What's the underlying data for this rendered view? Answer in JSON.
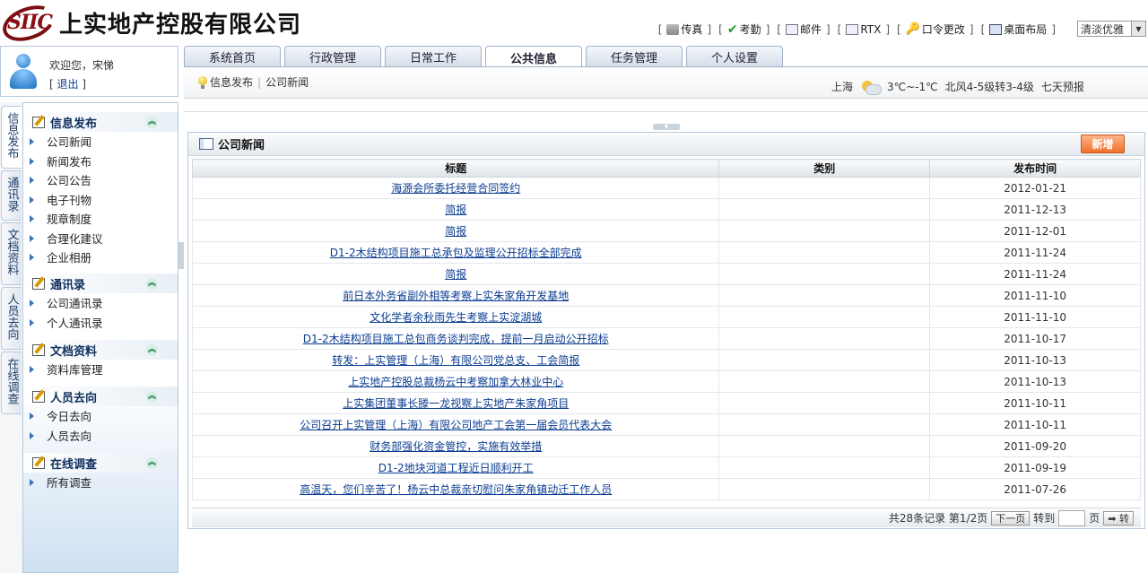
{
  "header": {
    "logo_letters": "SIIC",
    "company_name": "上实地产控股有限公司",
    "links": [
      {
        "label": "传真",
        "icon": "fax-icon"
      },
      {
        "label": "考勤",
        "icon": "check-icon"
      },
      {
        "label": "邮件",
        "icon": "mail-icon"
      },
      {
        "label": "RTX",
        "icon": "rtx-icon"
      },
      {
        "label": "口令更改",
        "icon": "key-icon"
      },
      {
        "label": "桌面布局",
        "icon": "desktop-icon"
      }
    ],
    "bracket_open": "[",
    "bracket_close": "]",
    "skin_select_value": "清淡优雅"
  },
  "user": {
    "welcome": "欢迎您，宋悌",
    "logout": "退出"
  },
  "tabs": [
    {
      "label": "系统首页"
    },
    {
      "label": "行政管理"
    },
    {
      "label": "日常工作"
    },
    {
      "label": "公共信息"
    },
    {
      "label": "任务管理"
    },
    {
      "label": "个人设置"
    }
  ],
  "breadcrumb": [
    "信息发布",
    "公司新闻"
  ],
  "weather": {
    "city": "上海",
    "temp": "3℃~-1℃",
    "wind": "北风4-5级转3-4级",
    "forecast_link": "七天预报"
  },
  "vtabs": [
    {
      "label": "信息发布"
    },
    {
      "label": "通讯录"
    },
    {
      "label": "文档资料"
    },
    {
      "label": "人员去向"
    },
    {
      "label": "在线调查"
    }
  ],
  "nav_groups": [
    {
      "title": "信息发布",
      "items": [
        "公司新闻",
        "新闻发布",
        "公司公告",
        "电子刊物",
        "规章制度",
        "合理化建议",
        "企业相册"
      ]
    },
    {
      "title": "通讯录",
      "items": [
        "公司通讯录",
        "个人通讯录"
      ]
    },
    {
      "title": "文档资料",
      "items": [
        "资料库管理"
      ]
    },
    {
      "title": "人员去向",
      "items": [
        "今日去向",
        "人员去向"
      ]
    },
    {
      "title": "在线调查",
      "items": [
        "所有调查"
      ]
    }
  ],
  "panel": {
    "title": "公司新闻",
    "new_button": "新增",
    "columns": [
      "标题",
      "类别",
      "发布时间"
    ],
    "rows": [
      {
        "title": "海源会所委托经营合同签约",
        "category": "",
        "date": "2012-01-21"
      },
      {
        "title": "简报",
        "category": "",
        "date": "2011-12-13"
      },
      {
        "title": "简报",
        "category": "",
        "date": "2011-12-01"
      },
      {
        "title": "D1-2木结构项目施工总承包及监理公开招标全部完成",
        "category": "",
        "date": "2011-11-24"
      },
      {
        "title": "简报",
        "category": "",
        "date": "2011-11-24"
      },
      {
        "title": "前日本外务省副外相等考察上实朱家角开发基地",
        "category": "",
        "date": "2011-11-10"
      },
      {
        "title": "文化学者余秋雨先生考察上实淀湖城",
        "category": "",
        "date": "2011-11-10"
      },
      {
        "title": "D1-2木结构项目施工总包商务谈判完成，提前一月启动公开招标",
        "category": "",
        "date": "2011-10-17"
      },
      {
        "title": "转发：上实管理（上海）有限公司党总支、工会简报",
        "category": "",
        "date": "2011-10-13"
      },
      {
        "title": "上实地产控股总裁杨云中考察加拿大林业中心",
        "category": "",
        "date": "2011-10-13"
      },
      {
        "title": "上实集团董事长滕一龙视察上实地产朱家角项目",
        "category": "",
        "date": "2011-10-11"
      },
      {
        "title": "公司召开上实管理（上海）有限公司地产工会第一届会员代表大会",
        "category": "",
        "date": "2011-10-11"
      },
      {
        "title": "财务部强化资金管控，实施有效举措",
        "category": "",
        "date": "2011-09-20"
      },
      {
        "title": "D1-2地块河道工程近日顺利开工",
        "category": "",
        "date": "2011-09-19"
      },
      {
        "title": "高温天，您们辛苦了！杨云中总裁亲切慰问朱家角镇动迁工作人员",
        "category": "",
        "date": "2011-07-26"
      }
    ],
    "pager": {
      "summary": "共28条记录 第1/2页",
      "next": "下一页",
      "goto_label": "转到",
      "page_unit": "页",
      "go_button": "➡ 转"
    }
  }
}
